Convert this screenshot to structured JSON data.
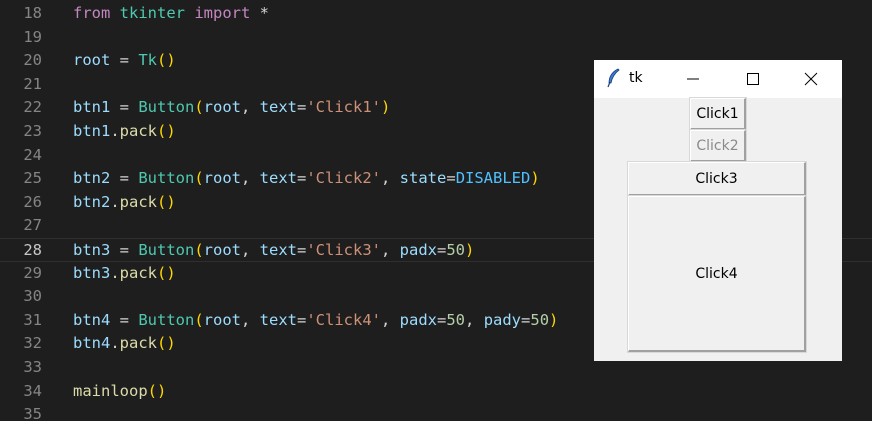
{
  "editor": {
    "current_line": 28,
    "lines": [
      {
        "num": "18",
        "tokens": [
          [
            "kw",
            "from"
          ],
          [
            "op",
            " "
          ],
          [
            "mod",
            "tkinter"
          ],
          [
            "op",
            " "
          ],
          [
            "kw",
            "import"
          ],
          [
            "op",
            " *"
          ]
        ]
      },
      {
        "num": "19",
        "tokens": []
      },
      {
        "num": "20",
        "tokens": [
          [
            "var",
            "root"
          ],
          [
            "op",
            " = "
          ],
          [
            "cls",
            "Tk"
          ],
          [
            "p",
            "()"
          ]
        ]
      },
      {
        "num": "21",
        "tokens": []
      },
      {
        "num": "22",
        "tokens": [
          [
            "var",
            "btn1"
          ],
          [
            "op",
            " = "
          ],
          [
            "cls",
            "Button"
          ],
          [
            "p",
            "("
          ],
          [
            "var",
            "root"
          ],
          [
            "op",
            ", "
          ],
          [
            "var",
            "text"
          ],
          [
            "op",
            "="
          ],
          [
            "str",
            "'Click1'"
          ],
          [
            "p",
            ")"
          ]
        ]
      },
      {
        "num": "23",
        "tokens": [
          [
            "var",
            "btn1"
          ],
          [
            "op",
            "."
          ],
          [
            "fn",
            "pack"
          ],
          [
            "p",
            "()"
          ]
        ]
      },
      {
        "num": "24",
        "tokens": []
      },
      {
        "num": "25",
        "tokens": [
          [
            "var",
            "btn2"
          ],
          [
            "op",
            " = "
          ],
          [
            "cls",
            "Button"
          ],
          [
            "p",
            "("
          ],
          [
            "var",
            "root"
          ],
          [
            "op",
            ", "
          ],
          [
            "var",
            "text"
          ],
          [
            "op",
            "="
          ],
          [
            "str",
            "'Click2'"
          ],
          [
            "op",
            ", "
          ],
          [
            "var",
            "state"
          ],
          [
            "op",
            "="
          ],
          [
            "con",
            "DISABLED"
          ],
          [
            "p",
            ")"
          ]
        ]
      },
      {
        "num": "26",
        "tokens": [
          [
            "var",
            "btn2"
          ],
          [
            "op",
            "."
          ],
          [
            "fn",
            "pack"
          ],
          [
            "p",
            "()"
          ]
        ]
      },
      {
        "num": "27",
        "tokens": []
      },
      {
        "num": "28",
        "tokens": [
          [
            "var",
            "btn3"
          ],
          [
            "op",
            " = "
          ],
          [
            "cls",
            "Button"
          ],
          [
            "p",
            "("
          ],
          [
            "var",
            "root"
          ],
          [
            "op",
            ", "
          ],
          [
            "var",
            "text"
          ],
          [
            "op",
            "="
          ],
          [
            "str",
            "'Click3'"
          ],
          [
            "op",
            ", "
          ],
          [
            "var",
            "padx"
          ],
          [
            "op",
            "="
          ],
          [
            "num",
            "50"
          ],
          [
            "p",
            ")"
          ]
        ]
      },
      {
        "num": "29",
        "tokens": [
          [
            "var",
            "btn3"
          ],
          [
            "op",
            "."
          ],
          [
            "fn",
            "pack"
          ],
          [
            "p",
            "()"
          ]
        ]
      },
      {
        "num": "30",
        "tokens": []
      },
      {
        "num": "31",
        "tokens": [
          [
            "var",
            "btn4"
          ],
          [
            "op",
            " = "
          ],
          [
            "cls",
            "Button"
          ],
          [
            "p",
            "("
          ],
          [
            "var",
            "root"
          ],
          [
            "op",
            ", "
          ],
          [
            "var",
            "text"
          ],
          [
            "op",
            "="
          ],
          [
            "str",
            "'Click4'"
          ],
          [
            "op",
            ", "
          ],
          [
            "var",
            "padx"
          ],
          [
            "op",
            "="
          ],
          [
            "num",
            "50"
          ],
          [
            "op",
            ", "
          ],
          [
            "var",
            "pady"
          ],
          [
            "op",
            "="
          ],
          [
            "num",
            "50"
          ],
          [
            "p",
            ")"
          ]
        ]
      },
      {
        "num": "32",
        "tokens": [
          [
            "var",
            "btn4"
          ],
          [
            "op",
            "."
          ],
          [
            "fn",
            "pack"
          ],
          [
            "p",
            "()"
          ]
        ]
      },
      {
        "num": "33",
        "tokens": []
      },
      {
        "num": "34",
        "tokens": [
          [
            "fn",
            "mainloop"
          ],
          [
            "p",
            "()"
          ]
        ]
      },
      {
        "num": "35",
        "tokens": []
      }
    ]
  },
  "tk_window": {
    "title": "tk",
    "icon": "feather-icon",
    "controls": [
      "minimize-icon",
      "maximize-icon",
      "close-icon"
    ],
    "buttons": {
      "click1": "Click1",
      "click2": "Click2",
      "click3": "Click3",
      "click4": "Click4"
    }
  },
  "colors": {
    "editor_bg": "#1e1e1e",
    "keyword": "#c586c0",
    "class": "#4ec9b0",
    "variable": "#9cdcfe",
    "string": "#ce9178",
    "number": "#b5cea8",
    "constant": "#4fc1ff",
    "function": "#dcdcaa",
    "paren": "#ffd700",
    "tk_bg": "#f0f0f0"
  }
}
